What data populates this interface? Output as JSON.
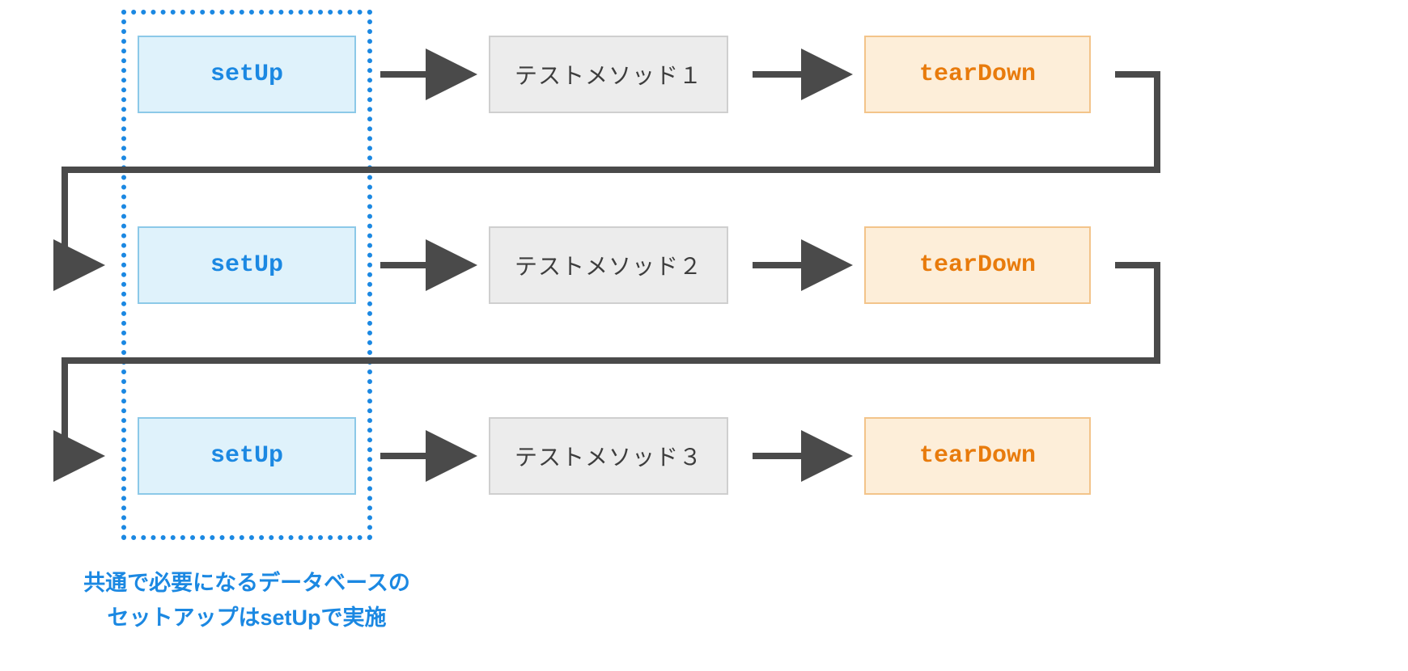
{
  "rows": [
    {
      "setup": "setUp",
      "test": "テストメソッド１",
      "teardown": "tearDown"
    },
    {
      "setup": "setUp",
      "test": "テストメソッド２",
      "teardown": "tearDown"
    },
    {
      "setup": "setUp",
      "test": "テストメソッド３",
      "teardown": "tearDown"
    }
  ],
  "caption_line1": "共通で必要になるデータベースの",
  "caption_line2": "セットアップはsetUpで実施",
  "colors": {
    "setup_bg": "#dff2fb",
    "setup_border": "#8cc9e8",
    "setup_text": "#1b88e2",
    "test_bg": "#ececec",
    "test_border": "#cfcfcf",
    "test_text": "#3d3d3d",
    "teardown_bg": "#fdeed9",
    "teardown_border": "#f3c48a",
    "teardown_text": "#e87b0c",
    "arrow": "#4a4a4a",
    "dashed": "#1b88e2"
  }
}
